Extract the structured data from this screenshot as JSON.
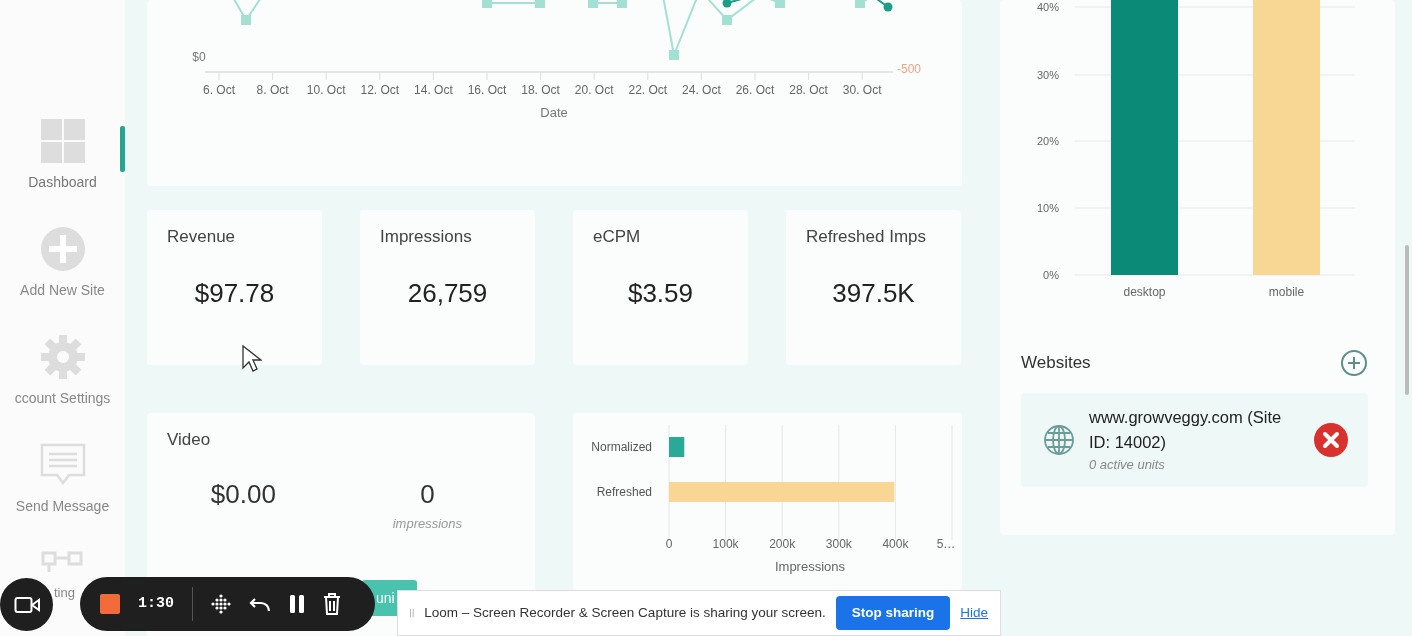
{
  "sidebar": {
    "items": [
      {
        "label": "Dashboard",
        "selected": true,
        "kind": "grid"
      },
      {
        "label": "Add New Site",
        "selected": false,
        "kind": "plus"
      },
      {
        "label": "ccount Settings",
        "selected": false,
        "kind": "gear"
      },
      {
        "label": "Send Message",
        "selected": false,
        "kind": "message"
      },
      {
        "label": "ting",
        "selected": false,
        "kind": "sitemap"
      }
    ]
  },
  "date_chart": {
    "y_label": "$0",
    "y2_label": "-500",
    "xlabel": "Date",
    "x_ticks": [
      "6. Oct",
      "8. Oct",
      "10. Oct",
      "12. Oct",
      "14. Oct",
      "16. Oct",
      "18. Oct",
      "20. Oct",
      "22. Oct",
      "24. Oct",
      "26. Oct",
      "28. Oct",
      "30. Oct"
    ]
  },
  "stats": [
    {
      "title": "Revenue",
      "value": "$97.78"
    },
    {
      "title": "Impressions",
      "value": "26,759"
    },
    {
      "title": "eCPM",
      "value": "$3.59"
    },
    {
      "title": "Refreshed Imps",
      "value": "397.5K"
    }
  ],
  "video": {
    "title": "Video",
    "revenue": "$0.00",
    "impressions": "0",
    "impressions_label": "impressions",
    "button": "uni"
  },
  "impressions_chart": {
    "chart_data": {
      "type": "bar",
      "orientation": "horizontal",
      "stacked": true,
      "grid": true,
      "xlabel": "Impressions",
      "xlim": [
        0,
        500000
      ],
      "xticks": [
        0,
        {
          "value": 100000,
          "label": "100k"
        },
        {
          "value": 200000,
          "label": "200k"
        },
        {
          "value": 300000,
          "label": "300k"
        },
        {
          "value": 400000,
          "label": "400k"
        },
        {
          "value": 500000,
          "label": "5…"
        }
      ],
      "series": [
        {
          "name": "Normalized",
          "color": "#2aa996",
          "values": [
            27000,
            null
          ]
        },
        {
          "name": "Refreshed",
          "color": "#f8d795",
          "values": [
            null,
            398000
          ]
        }
      ]
    }
  },
  "device_chart": {
    "yticks": [
      "40%",
      "30%",
      "20%",
      "10%",
      "0%"
    ],
    "categories": [
      {
        "label": "desktop",
        "color": "#0b8a78"
      },
      {
        "label": "mobile",
        "color": "#f8d795"
      }
    ]
  },
  "websites": {
    "title": "Websites",
    "sites": [
      {
        "name": "www.growveggy.com (Site ID: 14002)",
        "units": "0 active units"
      }
    ]
  },
  "recorder": {
    "time": "1:30"
  },
  "share_banner": {
    "message": "Loom – Screen Recorder & Screen Capture is sharing your screen.",
    "stop_button": "Stop sharing",
    "hide_link": "Hide"
  }
}
